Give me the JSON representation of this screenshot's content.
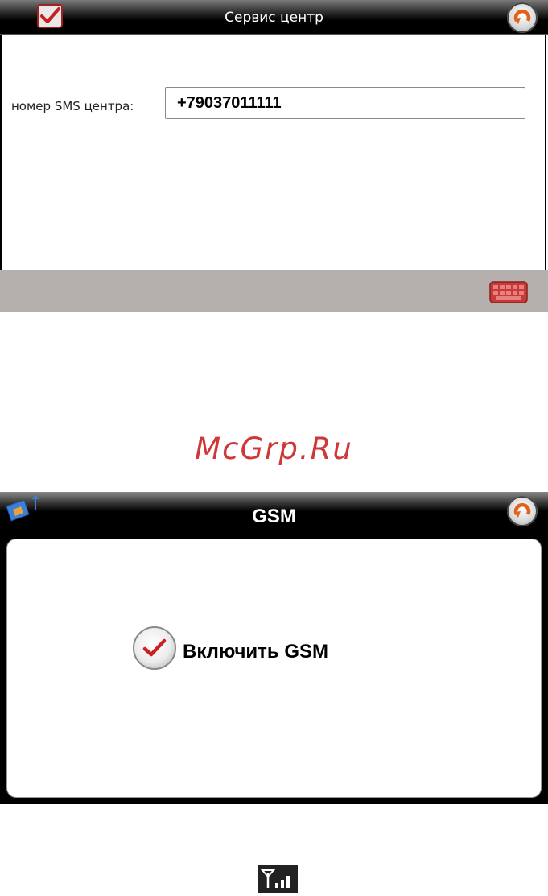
{
  "screen1": {
    "title": "Сервис центр",
    "sms_label": "номер SMS центра:",
    "sms_value": "+79037011111"
  },
  "watermark": "McGrp.Ru",
  "screen2": {
    "title": "GSM",
    "toggle_label": "Включить GSM",
    "toggle_checked": true
  },
  "icons": [
    "check-icon",
    "refresh-icon",
    "keyboard-icon",
    "sim-card-icon",
    "signal-icon"
  ],
  "colors": {
    "accent_red": "#d03838",
    "bottom_bar": "#b5b0ad",
    "title_bar": "#000000"
  }
}
